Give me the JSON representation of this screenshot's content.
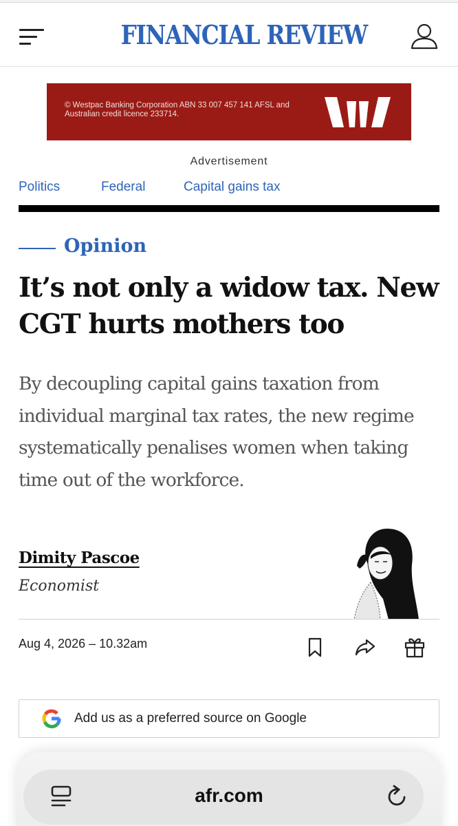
{
  "header": {
    "masthead": "FINANCIAL REVIEW",
    "brand_color": "#2e64b8",
    "icons": {
      "menu": "hamburger-menu-icon",
      "account": "user-account-icon"
    }
  },
  "advertisement": {
    "legal_text": "© Westpac Banking Corporation ABN 33 007 457 141 AFSL and Australian credit licence 233714.",
    "label": "Advertisement",
    "background_color": "#9a1b16",
    "logo": "westpac-logo"
  },
  "tags": [
    "Politics",
    "Federal",
    "Capital gains tax"
  ],
  "article": {
    "section": "Opinion",
    "headline": "It’s not only a widow tax. New CGT hurts mothers too",
    "standfirst": "By decoupling capital gains taxation from individual marginal tax rates, the new regime systematically penalises women when taking time out of the workforce.",
    "author": {
      "name": "Dimity Pascoe",
      "role": "Economist"
    },
    "dateline": "Aug 4, 2026 – 10.32am",
    "actions": [
      "bookmark-icon",
      "share-icon",
      "gift-icon"
    ]
  },
  "google_prompt": {
    "text": "Add us as a preferred source on Google",
    "icon": "google-g-icon"
  },
  "browser": {
    "url": "afr.com",
    "icons": {
      "tabs": "tabs-icon",
      "reload": "reload-icon"
    }
  }
}
